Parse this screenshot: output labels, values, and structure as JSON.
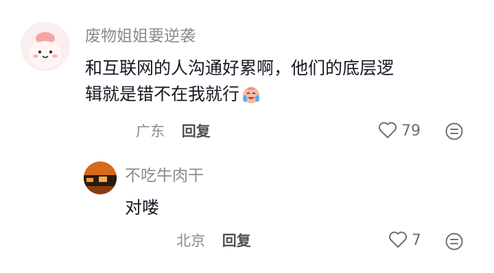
{
  "comments": [
    {
      "username": "废物姐姐要逆袭",
      "text": "和互联网的人沟通好累啊，他们的底层逻辑就是错不在我就行",
      "emoji": "crying-laughing-emoji",
      "location": "广东",
      "reply_label": "回复",
      "likes": "79"
    },
    {
      "username": "不吃牛肉干",
      "text": "对喽",
      "location": "北京",
      "reply_label": "回复",
      "likes": "7"
    }
  ],
  "colors": {
    "username": "#8a8a8a",
    "text": "#161823",
    "meta": "#8a8a8a",
    "reply": "#505050",
    "avatar_main_bg": "#fbeeee",
    "avatar_reply_bg": "#d46a1a"
  }
}
